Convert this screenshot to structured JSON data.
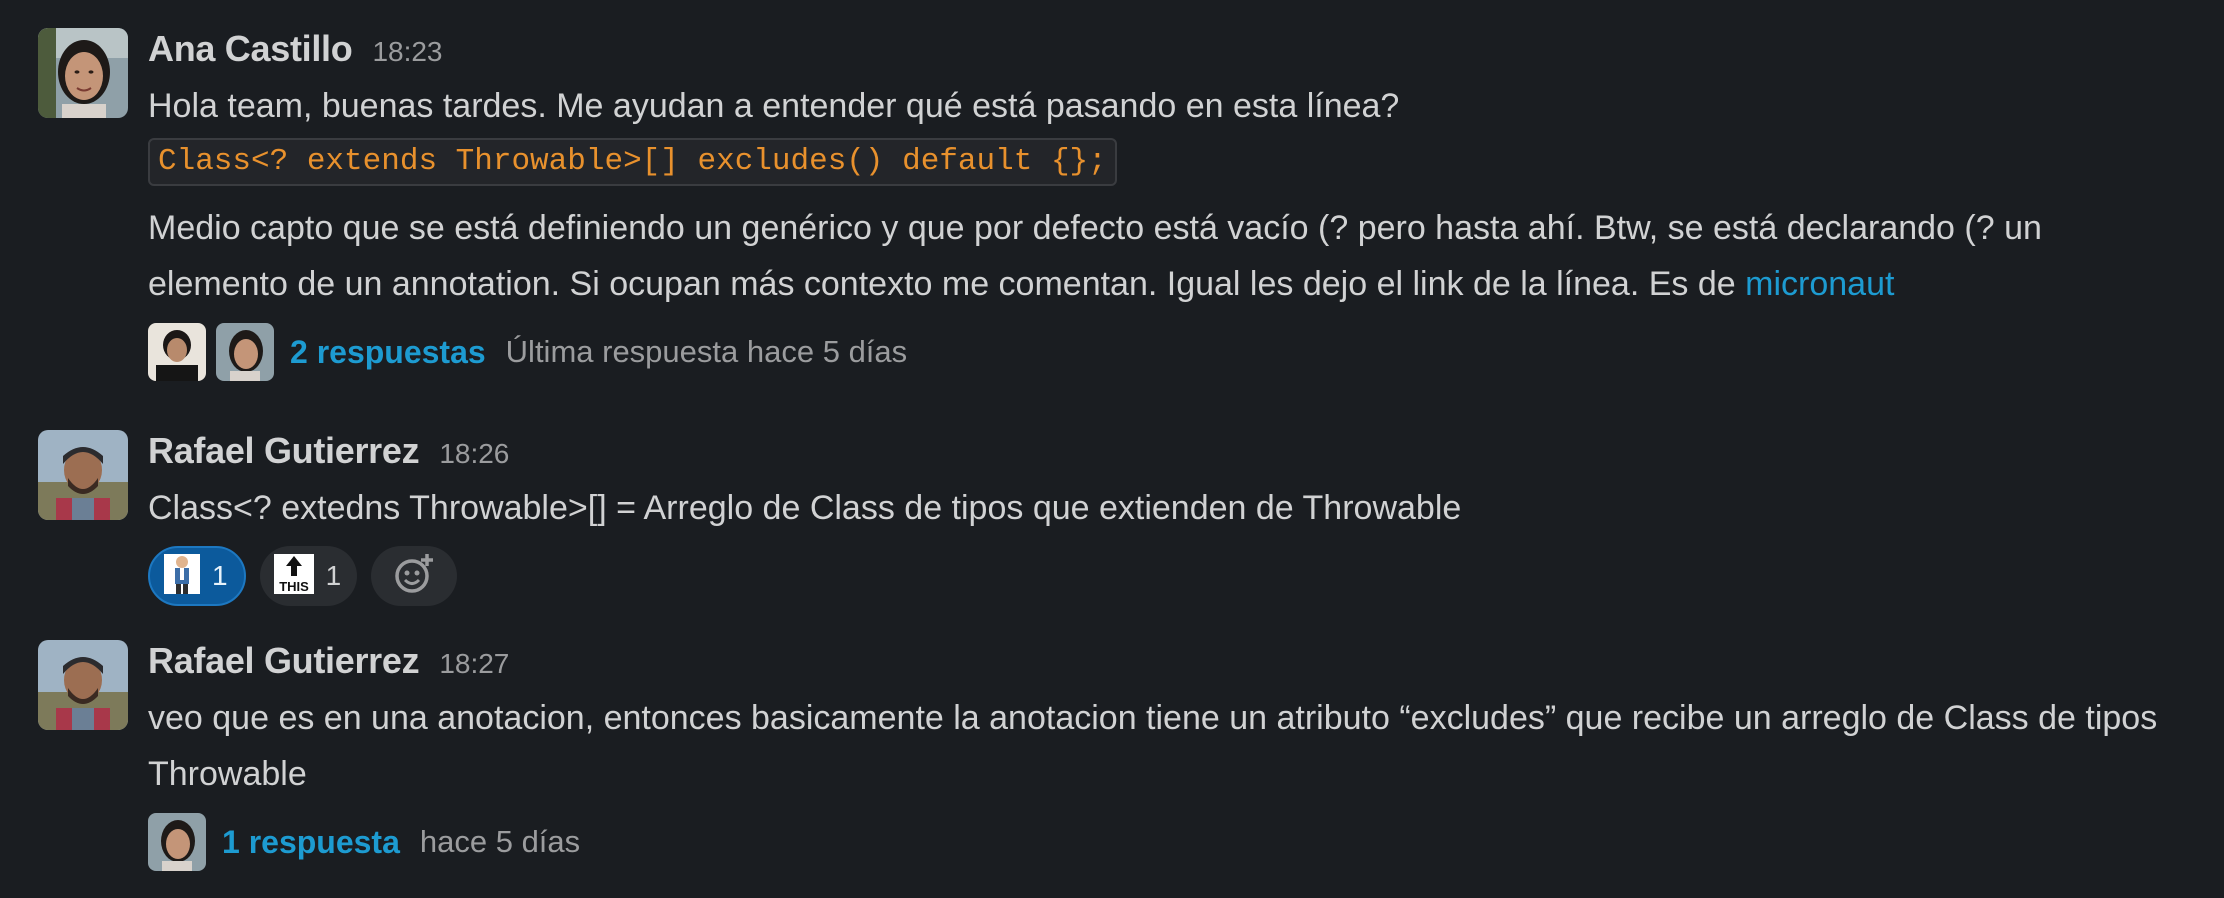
{
  "messages": [
    {
      "author": "Ana Castillo",
      "time": "18:23",
      "line1": "Hola team, buenas tardes. Me ayudan a entender qué está pasando en esta línea?",
      "code": "Class<? extends Throwable>[] excludes() default {};",
      "para": "Medio capto que se está definiendo un genérico y que por defecto está vacío (? pero hasta ahí. Btw, se está declarando (? un elemento de un annotation. Si ocupan más contexto me comentan. Igual les dejo el link de la línea. Es de",
      "link": "micronaut",
      "thread": {
        "replies": "2 respuestas",
        "last": "Última respuesta hace 5 días"
      }
    },
    {
      "author": "Rafael Gutierrez",
      "time": "18:26",
      "text": "Class<? extedns Throwable>[] = Arreglo de Class de tipos que extienden de Throwable",
      "reactions": [
        {
          "emoji": "person-pointing-emoji",
          "count": "1",
          "active": true
        },
        {
          "emoji": "this-arrow-emoji",
          "count": "1",
          "active": false
        }
      ]
    },
    {
      "author": "Rafael Gutierrez",
      "time": "18:27",
      "text": "veo que es en una anotacion, entonces basicamente la anotacion tiene un atributo “excludes” que recibe un arreglo de Class de tipos Throwable",
      "thread": {
        "replies": "1 respuesta",
        "last": "hace 5 días"
      }
    }
  ],
  "colors": {
    "background": "#1a1d21",
    "text": "#d1d2d3",
    "muted": "#9b9c9e",
    "link": "#1d9bd1",
    "code": "#e8912d",
    "reaction_active": "#0c5a9c"
  },
  "icons": {
    "add_reaction": "add-reaction-icon"
  }
}
